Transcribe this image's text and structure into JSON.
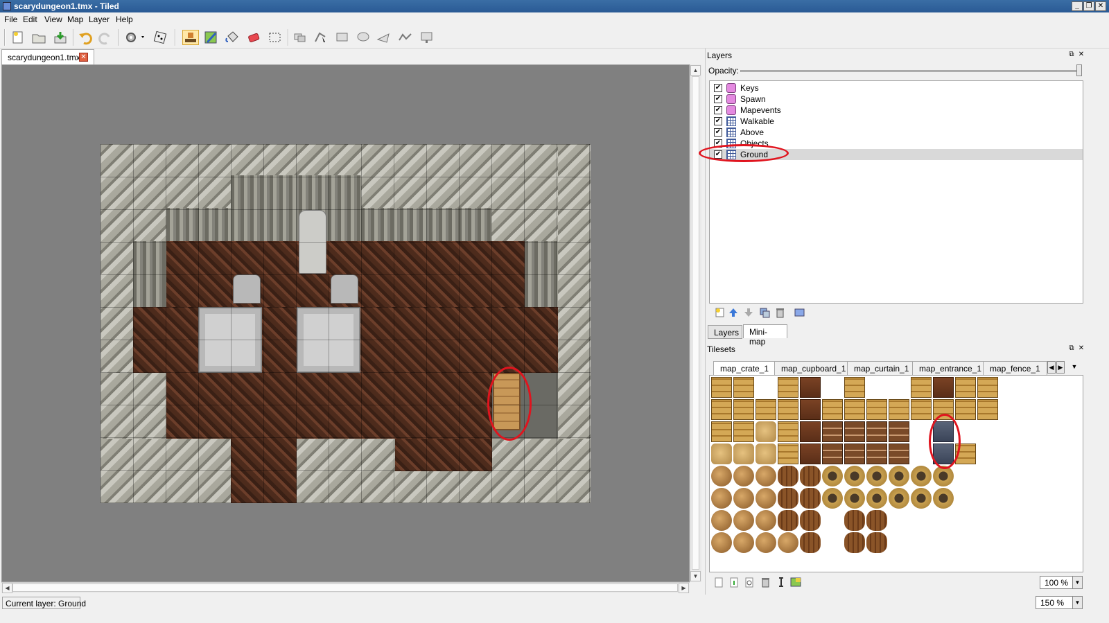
{
  "window": {
    "title": "scarydungeon1.tmx - Tiled",
    "controls": [
      "_",
      "❐",
      "✕"
    ]
  },
  "menubar": [
    "File",
    "Edit",
    "View",
    "Map",
    "Layer",
    "Help"
  ],
  "toolbar": {
    "tools": [
      "new-map",
      "open",
      "save",
      "undo",
      "redo",
      "commands",
      "random-mode",
      "stamp-brush",
      "terrain-brush",
      "bucket-fill",
      "eraser",
      "rectangular-select",
      "select-objects",
      "edit-polygons",
      "insert-rectangle",
      "insert-ellipse",
      "insert-polygon",
      "insert-polyline",
      "insert-tile"
    ],
    "selected_tool": "stamp-brush"
  },
  "document": {
    "tab_label": "scarydungeon1.tmx",
    "close": "✕"
  },
  "layers_panel": {
    "title": "Layers",
    "opacity_label": "Opacity:",
    "opacity": 1.0,
    "layers": [
      {
        "name": "Keys",
        "type": "object",
        "visible": true
      },
      {
        "name": "Spawn",
        "type": "object",
        "visible": true
      },
      {
        "name": "Mapevents",
        "type": "object",
        "visible": true
      },
      {
        "name": "Walkable",
        "type": "tile",
        "visible": true
      },
      {
        "name": "Above",
        "type": "tile",
        "visible": true
      },
      {
        "name": "Objects",
        "type": "tile",
        "visible": true
      },
      {
        "name": "Ground",
        "type": "tile",
        "visible": true,
        "selected": true
      }
    ],
    "check": "✔",
    "tabs": [
      "Layers",
      "Mini-map"
    ]
  },
  "tilesets_panel": {
    "title": "Tilesets",
    "tabs": [
      "map_crate_1",
      "map_cupboard_1",
      "map_curtain_1",
      "map_entrance_1",
      "map_fence_1"
    ],
    "active_tab": "map_crate_1",
    "nav": [
      "◀",
      "▶",
      "▼"
    ],
    "zoom": "100 %"
  },
  "dock_buttons": {
    "float": "⧉",
    "close": "✕"
  },
  "status": {
    "current_layer": "Current layer: Ground",
    "zoom": "150 %"
  },
  "scroll_arrows": {
    "up": "▲",
    "down": "▼",
    "left": "◀",
    "right": "▶"
  },
  "annotation_color": "#e0141e"
}
